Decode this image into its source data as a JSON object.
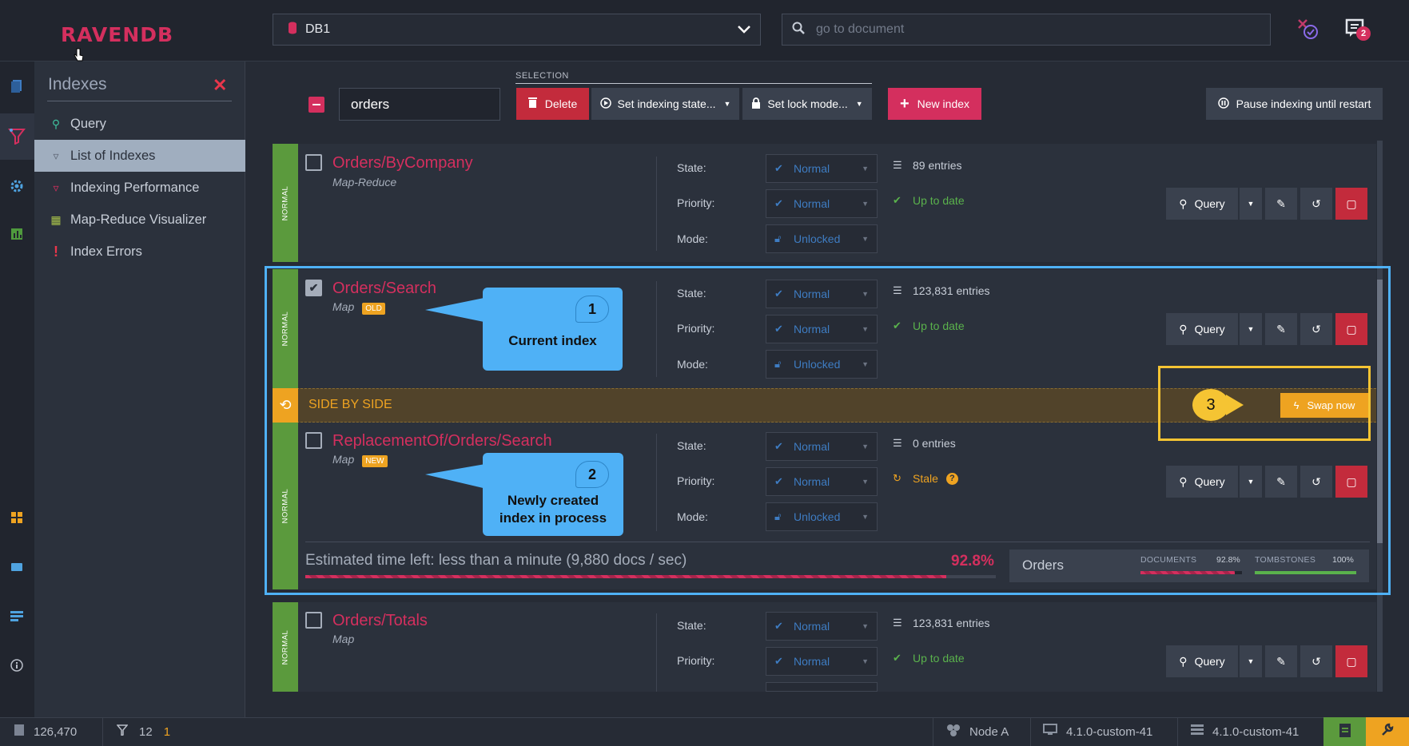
{
  "app": {
    "logo": "RAVENDB"
  },
  "topbar": {
    "database": "DB1",
    "search_placeholder": "go to document",
    "notifications_count": "2"
  },
  "menu": {
    "title": "Indexes",
    "items": [
      {
        "label": "Query"
      },
      {
        "label": "List of Indexes"
      },
      {
        "label": "Indexing Performance"
      },
      {
        "label": "Map-Reduce Visualizer"
      },
      {
        "label": "Index Errors"
      }
    ]
  },
  "toolbar": {
    "filter_value": "orders",
    "selection_label": "SELECTION",
    "delete_label": "Delete",
    "set_state_label": "Set indexing state...",
    "set_lock_label": "Set lock mode...",
    "new_index_label": "New index",
    "pause_label": "Pause indexing until restart"
  },
  "labels": {
    "state": "State:",
    "priority": "Priority:",
    "mode": "Mode:",
    "query": "Query",
    "normal_stripe": "NORMAL"
  },
  "indexes": [
    {
      "name": "Orders/ByCompany",
      "type": "Map-Reduce",
      "state": "Normal",
      "priority": "Normal",
      "mode": "Unlocked",
      "entries": "89 entries",
      "status": "Up to date"
    },
    {
      "name": "Orders/Search",
      "type": "Map",
      "badge": "OLD",
      "state": "Normal",
      "priority": "Normal",
      "mode": "Unlocked",
      "entries": "123,831 entries",
      "status": "Up to date"
    },
    {
      "name": "ReplacementOf/Orders/Search",
      "type": "Map",
      "badge": "NEW",
      "state": "Normal",
      "priority": "Normal",
      "mode": "Unlocked",
      "entries": "0 entries",
      "status": "Stale"
    },
    {
      "name": "Orders/Totals",
      "type": "Map",
      "state": "Normal",
      "priority": "Normal",
      "entries": "123,831 entries",
      "status": "Up to date"
    }
  ],
  "side_by_side": {
    "label": "SIDE BY SIDE",
    "swap_label": "Swap now"
  },
  "progress": {
    "eta": "Estimated time left: less than a minute (9,880 docs / sec)",
    "percent_text": "92.8%",
    "percent": 92.8,
    "collection": "Orders",
    "documents_label": "DOCUMENTS",
    "documents_pct": "92.8%",
    "documents_value": 92.8,
    "tombstones_label": "TOMBSTONES",
    "tombstones_pct": "100%",
    "tombstones_value": 100
  },
  "callouts": [
    {
      "num": "1",
      "text": "Current index"
    },
    {
      "num": "2",
      "text_line1": "Newly created",
      "text_line2": "index in process"
    },
    {
      "num": "3"
    }
  ],
  "footer": {
    "docs_count": "126,470",
    "index_count": "12",
    "index_errors": "1",
    "node": "Node A",
    "client_version": "4.1.0-custom-41",
    "server_version": "4.1.0-custom-41"
  },
  "colors": {
    "accent": "#d42f5e",
    "normal": "#5b9a3d",
    "warning": "#eea321",
    "callout": "#4fb1f6",
    "highlight": "#f5c433"
  }
}
